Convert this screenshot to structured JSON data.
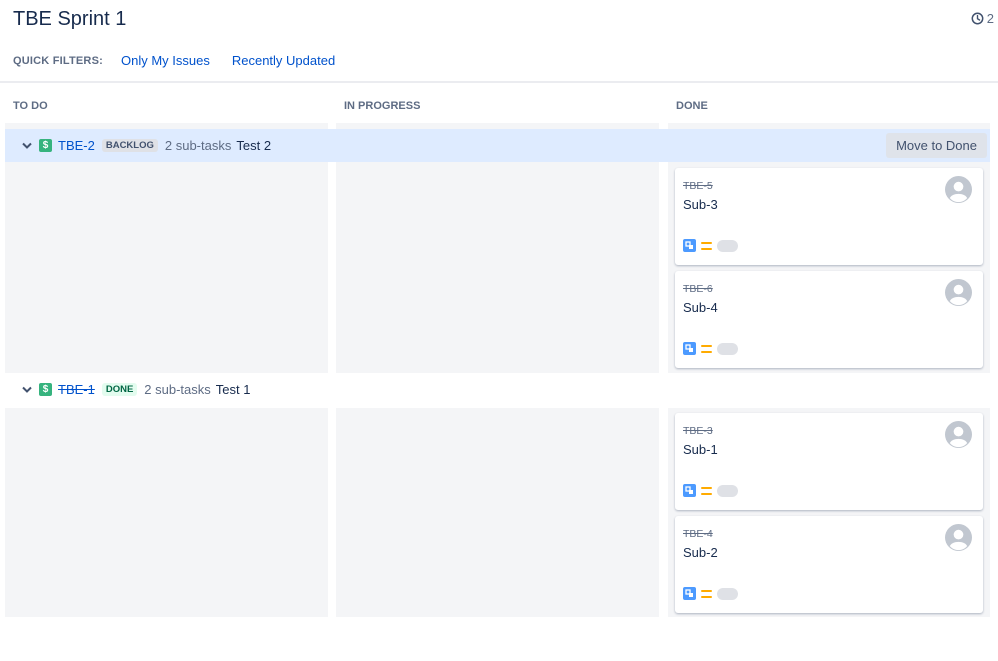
{
  "header": {
    "title": "TBE Sprint 1",
    "days_remaining": "2",
    "clock_icon": "clock-icon"
  },
  "quick_filters": {
    "label": "QUICK FILTERS:",
    "items": [
      "Only My Issues",
      "Recently Updated"
    ]
  },
  "columns": [
    "TO DO",
    "IN PROGRESS",
    "DONE"
  ],
  "swimlanes": [
    {
      "key": "TBE-2",
      "status": "BACKLOG",
      "subtasks": "2 sub-tasks",
      "summary": "Test 2",
      "action": "Move to Done",
      "cards": [
        {
          "key": "TBE-5",
          "summary": "Sub-3"
        },
        {
          "key": "TBE-6",
          "summary": "Sub-4"
        }
      ]
    },
    {
      "key": "TBE-1",
      "status": "DONE",
      "subtasks": "2 sub-tasks",
      "summary": "Test 1",
      "cards": [
        {
          "key": "TBE-3",
          "summary": "Sub-1"
        },
        {
          "key": "TBE-4",
          "summary": "Sub-2"
        }
      ]
    }
  ],
  "colors": {
    "link": "#0052cc",
    "swimlane_active": "#deebff",
    "column_bg": "#f4f5f7",
    "story": "#36b37e",
    "subtask": "#4c9aff",
    "priority_medium": "#ffab00"
  }
}
